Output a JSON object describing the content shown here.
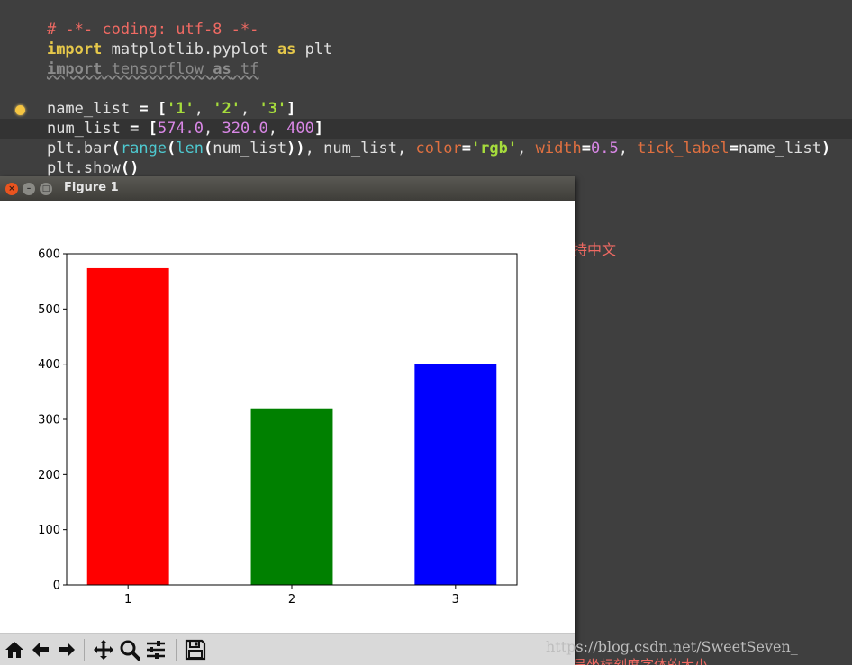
{
  "editor": {
    "line1": "# -*- coding: utf-8 -*-",
    "line2_kw": "import",
    "line2_rest": " matplotlib.pyplot ",
    "line2_as": "as",
    "line2_alias": " plt",
    "line3_kw": "import",
    "line3_rest": " tensorflow ",
    "line3_as": "as",
    "line3_alias": " tf",
    "line5_var": "name_list",
    "line5_eq": " = ",
    "line5_open": "[",
    "line5_s1": "'1'",
    "line5_c1": ", ",
    "line5_s2": "'2'",
    "line5_c2": ", ",
    "line5_s3": "'3'",
    "line5_close": "]",
    "line6_var_a": "n",
    "line6_var_b": "um_list",
    "line6_eq": " = ",
    "line6_open": "[",
    "line6_n1": "574.0",
    "line6_c1": ", ",
    "line6_n2": "320.0",
    "line6_c2": ", ",
    "line6_n3": "400",
    "line6_close": "]",
    "line7_a": "plt.bar",
    "line7_p1": "(",
    "line7_range": "range",
    "line7_p2": "(",
    "line7_len": "len",
    "line7_p3": "(",
    "line7_arg": "num_list",
    "line7_p4": "))",
    "line7_c1": ", ",
    "line7_nl": "num_list",
    "line7_c2": ", ",
    "line7_color": "color",
    "line7_eq1": "=",
    "line7_rgb": "'rgb'",
    "line7_c3": ", ",
    "line7_width": "width",
    "line7_eq2": "=",
    "line7_w": "0.5",
    "line7_c4": ", ",
    "line7_tick": "tick_label",
    "line7_eq3": "=",
    "line7_names": "name_list",
    "line7_close": ")",
    "line8_a": "plt.show",
    "line8_b": "()"
  },
  "background_text": {
    "cn_right": "持中文",
    "cn_bottom": "是坐标刻度字体的大小",
    "watermark": "https://blog.csdn.net/SweetSeven_"
  },
  "figure_window": {
    "title": "Figure 1",
    "close_glyph": "×",
    "min_glyph": "–",
    "max_glyph": "□"
  },
  "toolbar": {
    "icons": [
      "home-icon",
      "back-arrow-icon",
      "forward-arrow-icon",
      "pan-icon",
      "zoom-icon",
      "subplots-config-icon",
      "save-icon"
    ]
  },
  "chart_data": {
    "type": "bar",
    "categories": [
      "1",
      "2",
      "3"
    ],
    "values": [
      574.0,
      320.0,
      400
    ],
    "colors": [
      "#ff0000",
      "#008000",
      "#0000ff"
    ],
    "bar_width": 0.5,
    "ylim": [
      0,
      600
    ],
    "yticks": [
      0,
      100,
      200,
      300,
      400,
      500,
      600
    ],
    "xlabel": "",
    "ylabel": "",
    "title": "",
    "grid": false
  }
}
